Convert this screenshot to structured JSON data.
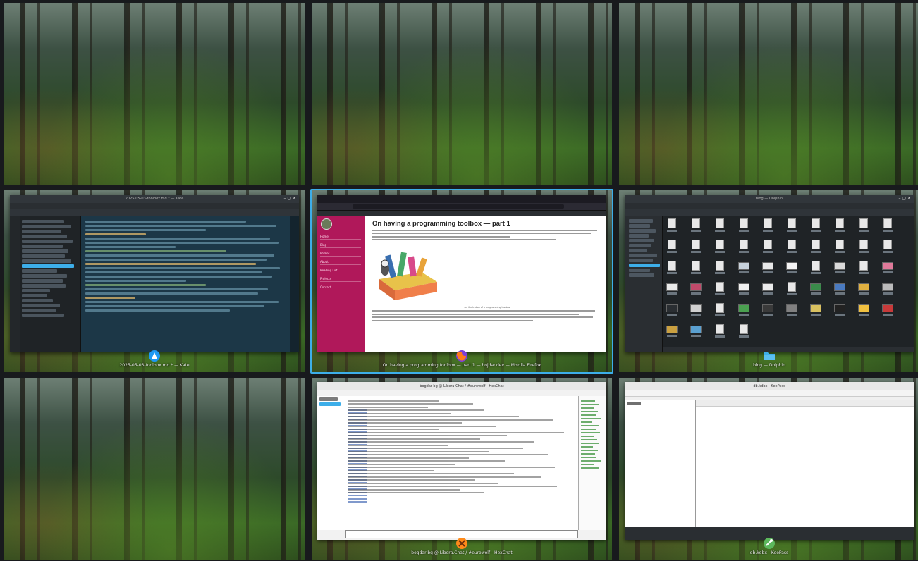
{
  "overview": {
    "cells": [
      {
        "id": "desk1-empty"
      },
      {
        "id": "desk2-empty"
      },
      {
        "id": "desk3-empty"
      },
      {
        "id": "kate",
        "title": "2025-05-03-toolbox.md * — Kate",
        "caption": "2025-05-03-toolbox.md * — Kate",
        "icon": "kate-icon"
      },
      {
        "id": "firefox",
        "title": "On having a programming toolbox — part 1 — hojdar.dev — Mozilla Firefox",
        "caption": "On having a programming toolbox — part 1 — hojdar.dev — Mozilla Firefox",
        "icon": "firefox-icon",
        "active": true,
        "page": {
          "heading": "On having a programming toolbox — part 1",
          "nav": [
            "Home",
            "Blog",
            "Photos",
            "About",
            "Reading List",
            "Projects",
            "Contact"
          ],
          "figcaption": "An illustration of a programming toolbox"
        }
      },
      {
        "id": "dolphin",
        "title": "blog — Dolphin",
        "caption": "blog — Dolphin",
        "icon": "folder-icon"
      },
      {
        "id": "desk7-empty"
      },
      {
        "id": "hexchat",
        "title": "bogdar-bg @ Libera.Chat / #eurowolf - HexChat",
        "caption": "bogdar-bg @ Libera.Chat / #eurowolf - HexChat",
        "icon": "hexchat-icon"
      },
      {
        "id": "keepass",
        "title": "db.kdbx - KeePass",
        "caption": "db.kdbx - KeePass",
        "icon": "keepass-icon"
      }
    ]
  },
  "colors": {
    "accent": "#3daee9",
    "site_sidebar": "#b0185a",
    "kate_bg": "#1c3747"
  }
}
